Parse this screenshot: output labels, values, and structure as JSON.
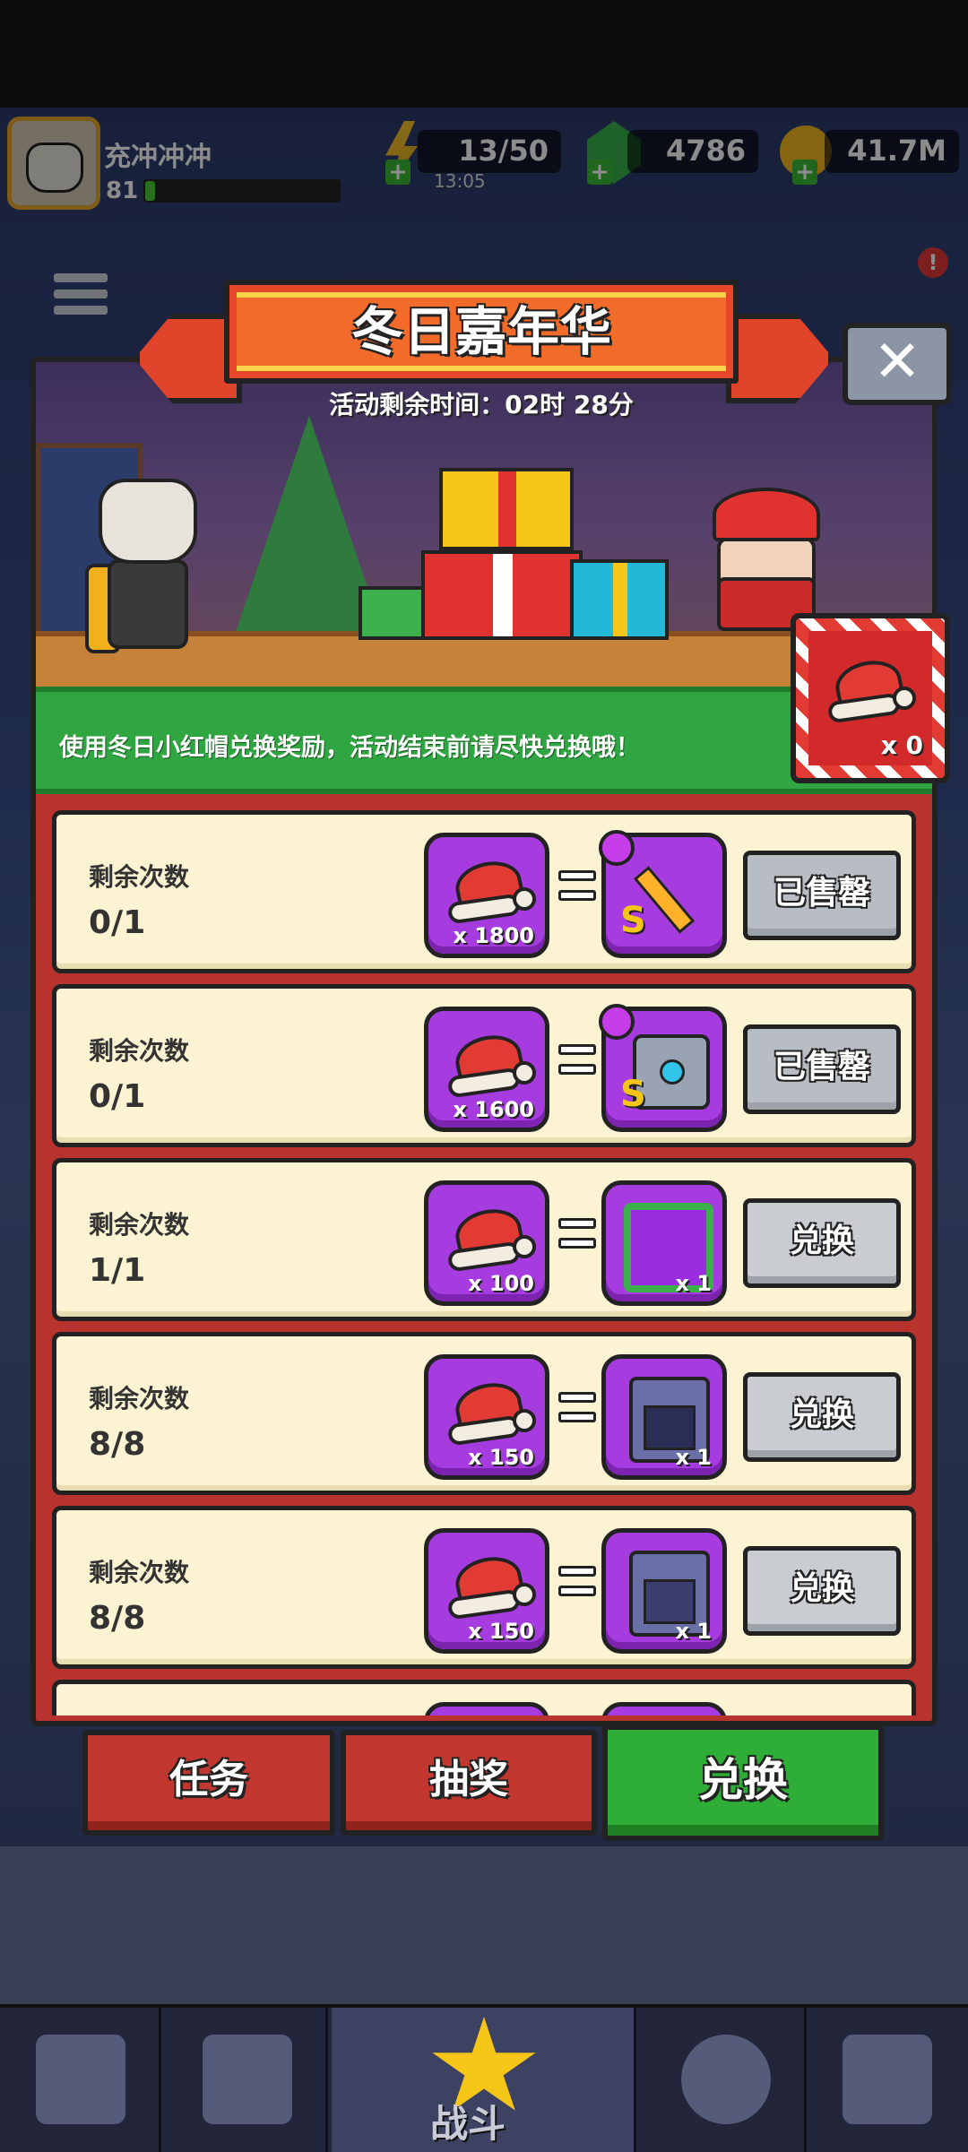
{
  "header": {
    "player_name": "充冲冲冲",
    "level": "81",
    "xp_fraction": 0.05,
    "energy": "13/50",
    "energy_timer": "13:05",
    "gems": "4786",
    "coins": "41.7M",
    "notification_badge": "!"
  },
  "event": {
    "title": "冬日嘉年华",
    "countdown": "活动剩余时间：02时 28分",
    "instructions": "使用冬日小红帽兑换奖励，活动结束前请尽快兑换哦！",
    "hat_balance": "x 0",
    "close_label": "✕"
  },
  "offers": [
    {
      "label": "剩余次数",
      "remaining": "0/1",
      "cost": "x 1800",
      "reward_icon": "sword-icon",
      "reward_qty": "",
      "action": "已售罄"
    },
    {
      "label": "剩余次数",
      "remaining": "0/1",
      "cost": "x 1600",
      "reward_icon": "armor-icon",
      "reward_qty": "",
      "action": "已售罄"
    },
    {
      "label": "剩余次数",
      "remaining": "1/1",
      "cost": "x 100",
      "reward_icon": "avatar-frame-icon",
      "reward_qty": "x 1",
      "action": "兑换"
    },
    {
      "label": "剩余次数",
      "remaining": "8/8",
      "cost": "x 150",
      "reward_icon": "weapon-chest-icon",
      "reward_qty": "x 1",
      "action": "兑换"
    },
    {
      "label": "剩余次数",
      "remaining": "8/8",
      "cost": "x 150",
      "reward_icon": "armor-chest-icon",
      "reward_qty": "x 1",
      "action": "兑换"
    }
  ],
  "tabs": [
    {
      "label": "任务"
    },
    {
      "label": "抽奖"
    },
    {
      "label": "兑换"
    }
  ],
  "nav": {
    "battle_label": "战斗"
  },
  "colors": {
    "panel": "#b8332d",
    "slot": "#a63ce0",
    "active_tab": "#2fae37",
    "info_strip": "#2fa641"
  }
}
